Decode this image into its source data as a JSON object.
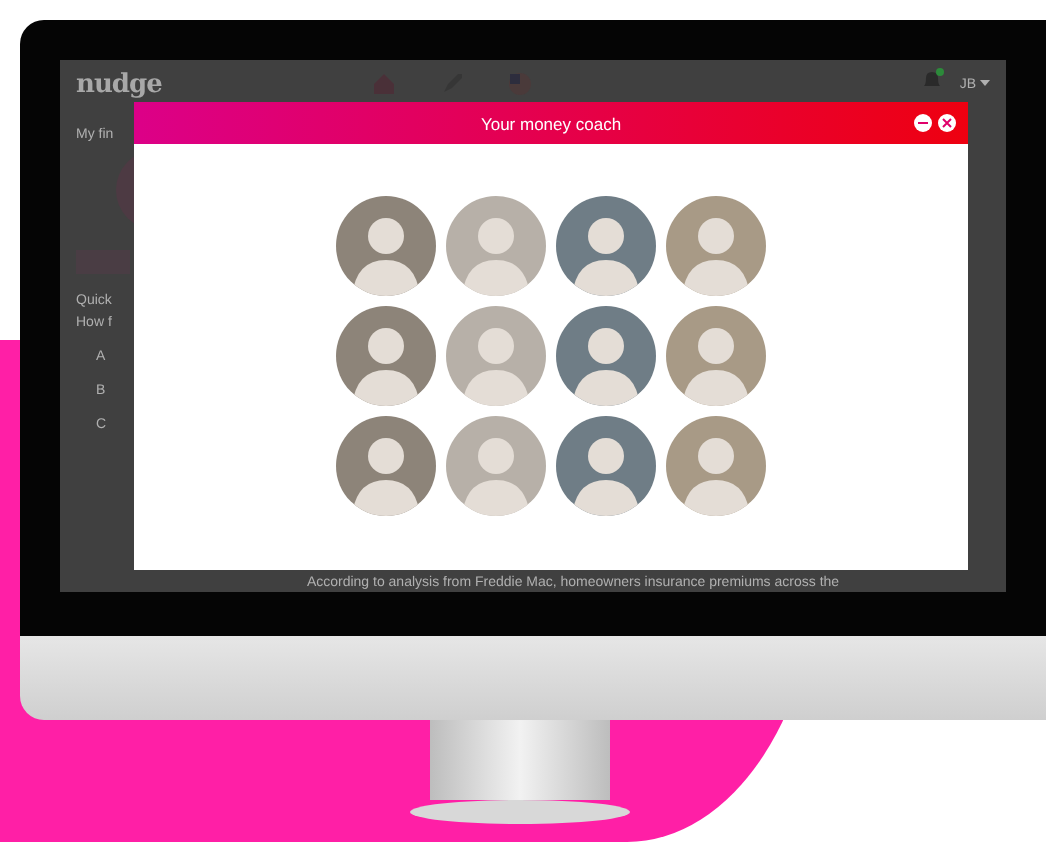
{
  "app": {
    "logo": "nudge",
    "user": "JB",
    "notification": true,
    "sidebar": [
      {
        "kind": "heading",
        "text": "My fin"
      },
      {
        "kind": "avatar"
      },
      {
        "kind": "bar"
      },
      {
        "kind": "heading",
        "text": "Quick"
      },
      {
        "kind": "heading",
        "text": "How f"
      },
      {
        "kind": "option",
        "text": "A"
      },
      {
        "kind": "option",
        "text": "B"
      },
      {
        "kind": "option",
        "text": "C"
      }
    ],
    "footer": "According to analysis from Freddie Mac, homeowners insurance premiums across the"
  },
  "modal": {
    "title": "Your money coach",
    "coaches": [
      {
        "kind": "photo"
      },
      {
        "kind": "photo"
      },
      {
        "kind": "photo"
      },
      {
        "kind": "photo"
      },
      {
        "kind": "photo"
      },
      {
        "kind": "photo"
      },
      {
        "kind": "photo"
      },
      {
        "kind": "photo"
      },
      {
        "kind": "photo"
      },
      {
        "kind": "photo"
      },
      {
        "kind": "photo"
      },
      {
        "kind": "photo"
      }
    ]
  }
}
